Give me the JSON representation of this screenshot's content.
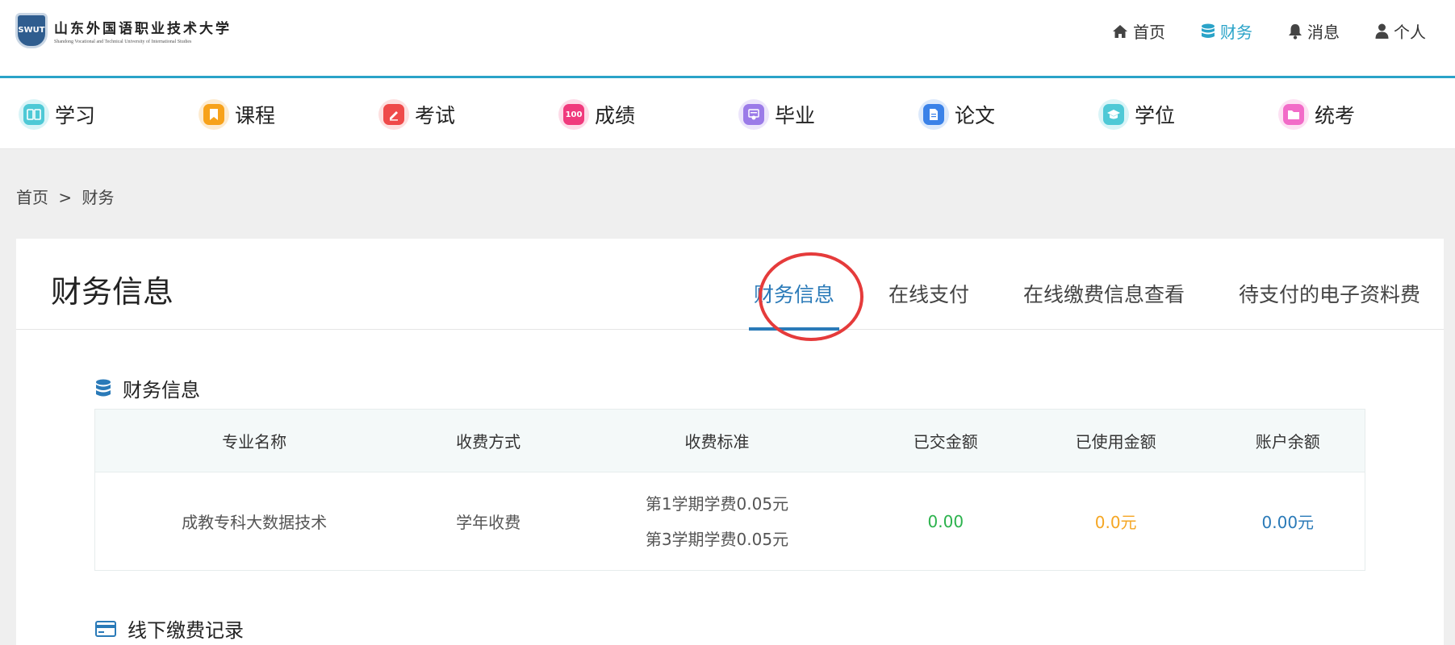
{
  "logo": {
    "badge": "SWUT",
    "cn": "山东外国语职业技术大学",
    "en": "Shandong Vocational and Technical University of International Studies"
  },
  "top_nav": [
    {
      "label": "首页",
      "icon": "home-icon"
    },
    {
      "label": "财务",
      "icon": "database-icon",
      "active": true
    },
    {
      "label": "消息",
      "icon": "bell-icon"
    },
    {
      "label": "个人",
      "icon": "user-icon"
    }
  ],
  "modules": [
    {
      "label": "学习",
      "icon": "book-open-icon",
      "color": "#4fc9d6"
    },
    {
      "label": "课程",
      "icon": "bookmark-icon",
      "color": "#f7a21b"
    },
    {
      "label": "考试",
      "icon": "pencil-icon",
      "color": "#ef4a4a"
    },
    {
      "label": "成绩",
      "icon": "score-100-icon",
      "color": "#f03a7d",
      "icon_text": "100"
    },
    {
      "label": "毕业",
      "icon": "certificate-icon",
      "color": "#9b7be8"
    },
    {
      "label": "论文",
      "icon": "document-icon",
      "color": "#3b82e8"
    },
    {
      "label": "学位",
      "icon": "graduation-cap-icon",
      "color": "#4fc9d6"
    },
    {
      "label": "统考",
      "icon": "folder-icon",
      "color": "#f26bc8"
    }
  ],
  "breadcrumb": {
    "home": "首页",
    "separator": ">",
    "current": "财务"
  },
  "panel": {
    "title": "财务信息",
    "tabs": [
      {
        "label": "财务信息",
        "active": true
      },
      {
        "label": "在线支付"
      },
      {
        "label": "在线缴费信息查看"
      },
      {
        "label": "待支付的电子资料费"
      }
    ]
  },
  "finance_section": {
    "title": "财务信息",
    "icon": "database-icon",
    "columns": [
      "专业名称",
      "收费方式",
      "收费标准",
      "已交金额",
      "已使用金额",
      "账户余额"
    ],
    "rows": [
      {
        "major": "成教专科大数据技术",
        "method": "学年收费",
        "standards": [
          "第1学期学费0.05元",
          "第3学期学费0.05元"
        ],
        "paid": "0.00",
        "used": "0.0元",
        "balance": "0.00元"
      }
    ]
  },
  "offline_section": {
    "title": "线下缴费记录",
    "icon": "credit-card-icon"
  },
  "colors": {
    "accent": "#2aa3c8",
    "tab_active": "#2a7ab8",
    "paid": "#2bb24c",
    "used": "#f5a623",
    "balance": "#2a7ab8",
    "annotation": "#e53b3b"
  }
}
